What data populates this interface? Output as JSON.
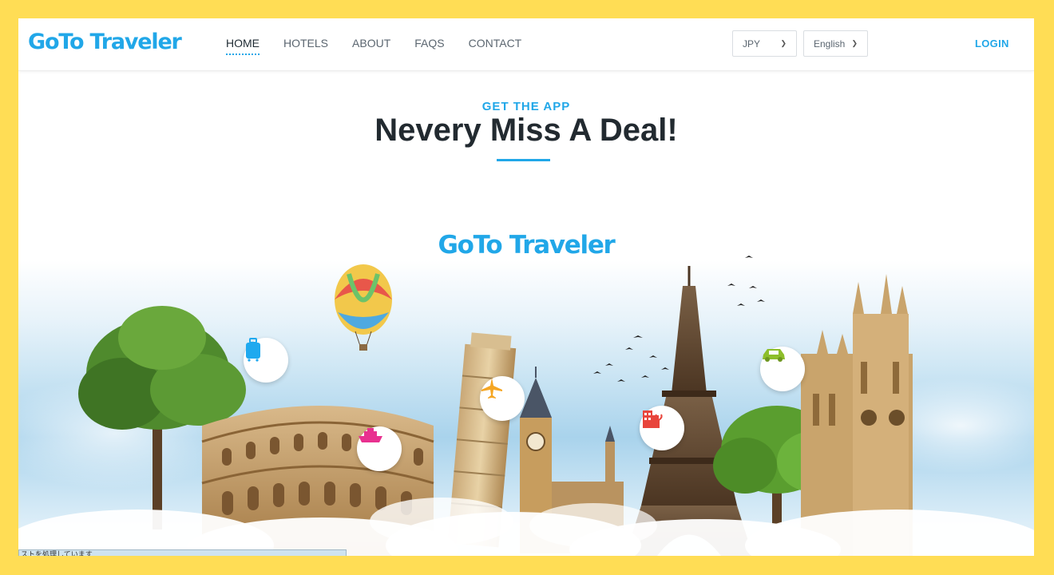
{
  "brand": {
    "name": "GoTo Traveler",
    "accent": "#21A7E8",
    "frame_bg": "#FFDD55"
  },
  "nav": {
    "items": [
      {
        "label": "HOME",
        "active": true
      },
      {
        "label": "HOTELS",
        "active": false
      },
      {
        "label": "ABOUT",
        "active": false
      },
      {
        "label": "FAQS",
        "active": false
      },
      {
        "label": "CONTACT",
        "active": false
      }
    ]
  },
  "currency": {
    "value": "JPY",
    "icon": "chevron-down-icon"
  },
  "language": {
    "value": "English",
    "icon": "chevron-down-icon"
  },
  "login_label": "LOGIN",
  "hero": {
    "eyebrow": "GET THE APP",
    "headline": "Nevery Miss A Deal!",
    "scene_logo": "GoTo Traveler"
  },
  "scene_badges": [
    {
      "icon": "suitcase-icon",
      "color": "#1FA9EF"
    },
    {
      "icon": "cruise-ship-icon",
      "color": "#E8318F"
    },
    {
      "icon": "airplane-icon",
      "color": "#F5A623"
    },
    {
      "icon": "hotel-building-icon",
      "color": "#E8453C"
    },
    {
      "icon": "car-icon",
      "color": "#8DBE2A"
    }
  ],
  "status_text": "ストを処理しています"
}
